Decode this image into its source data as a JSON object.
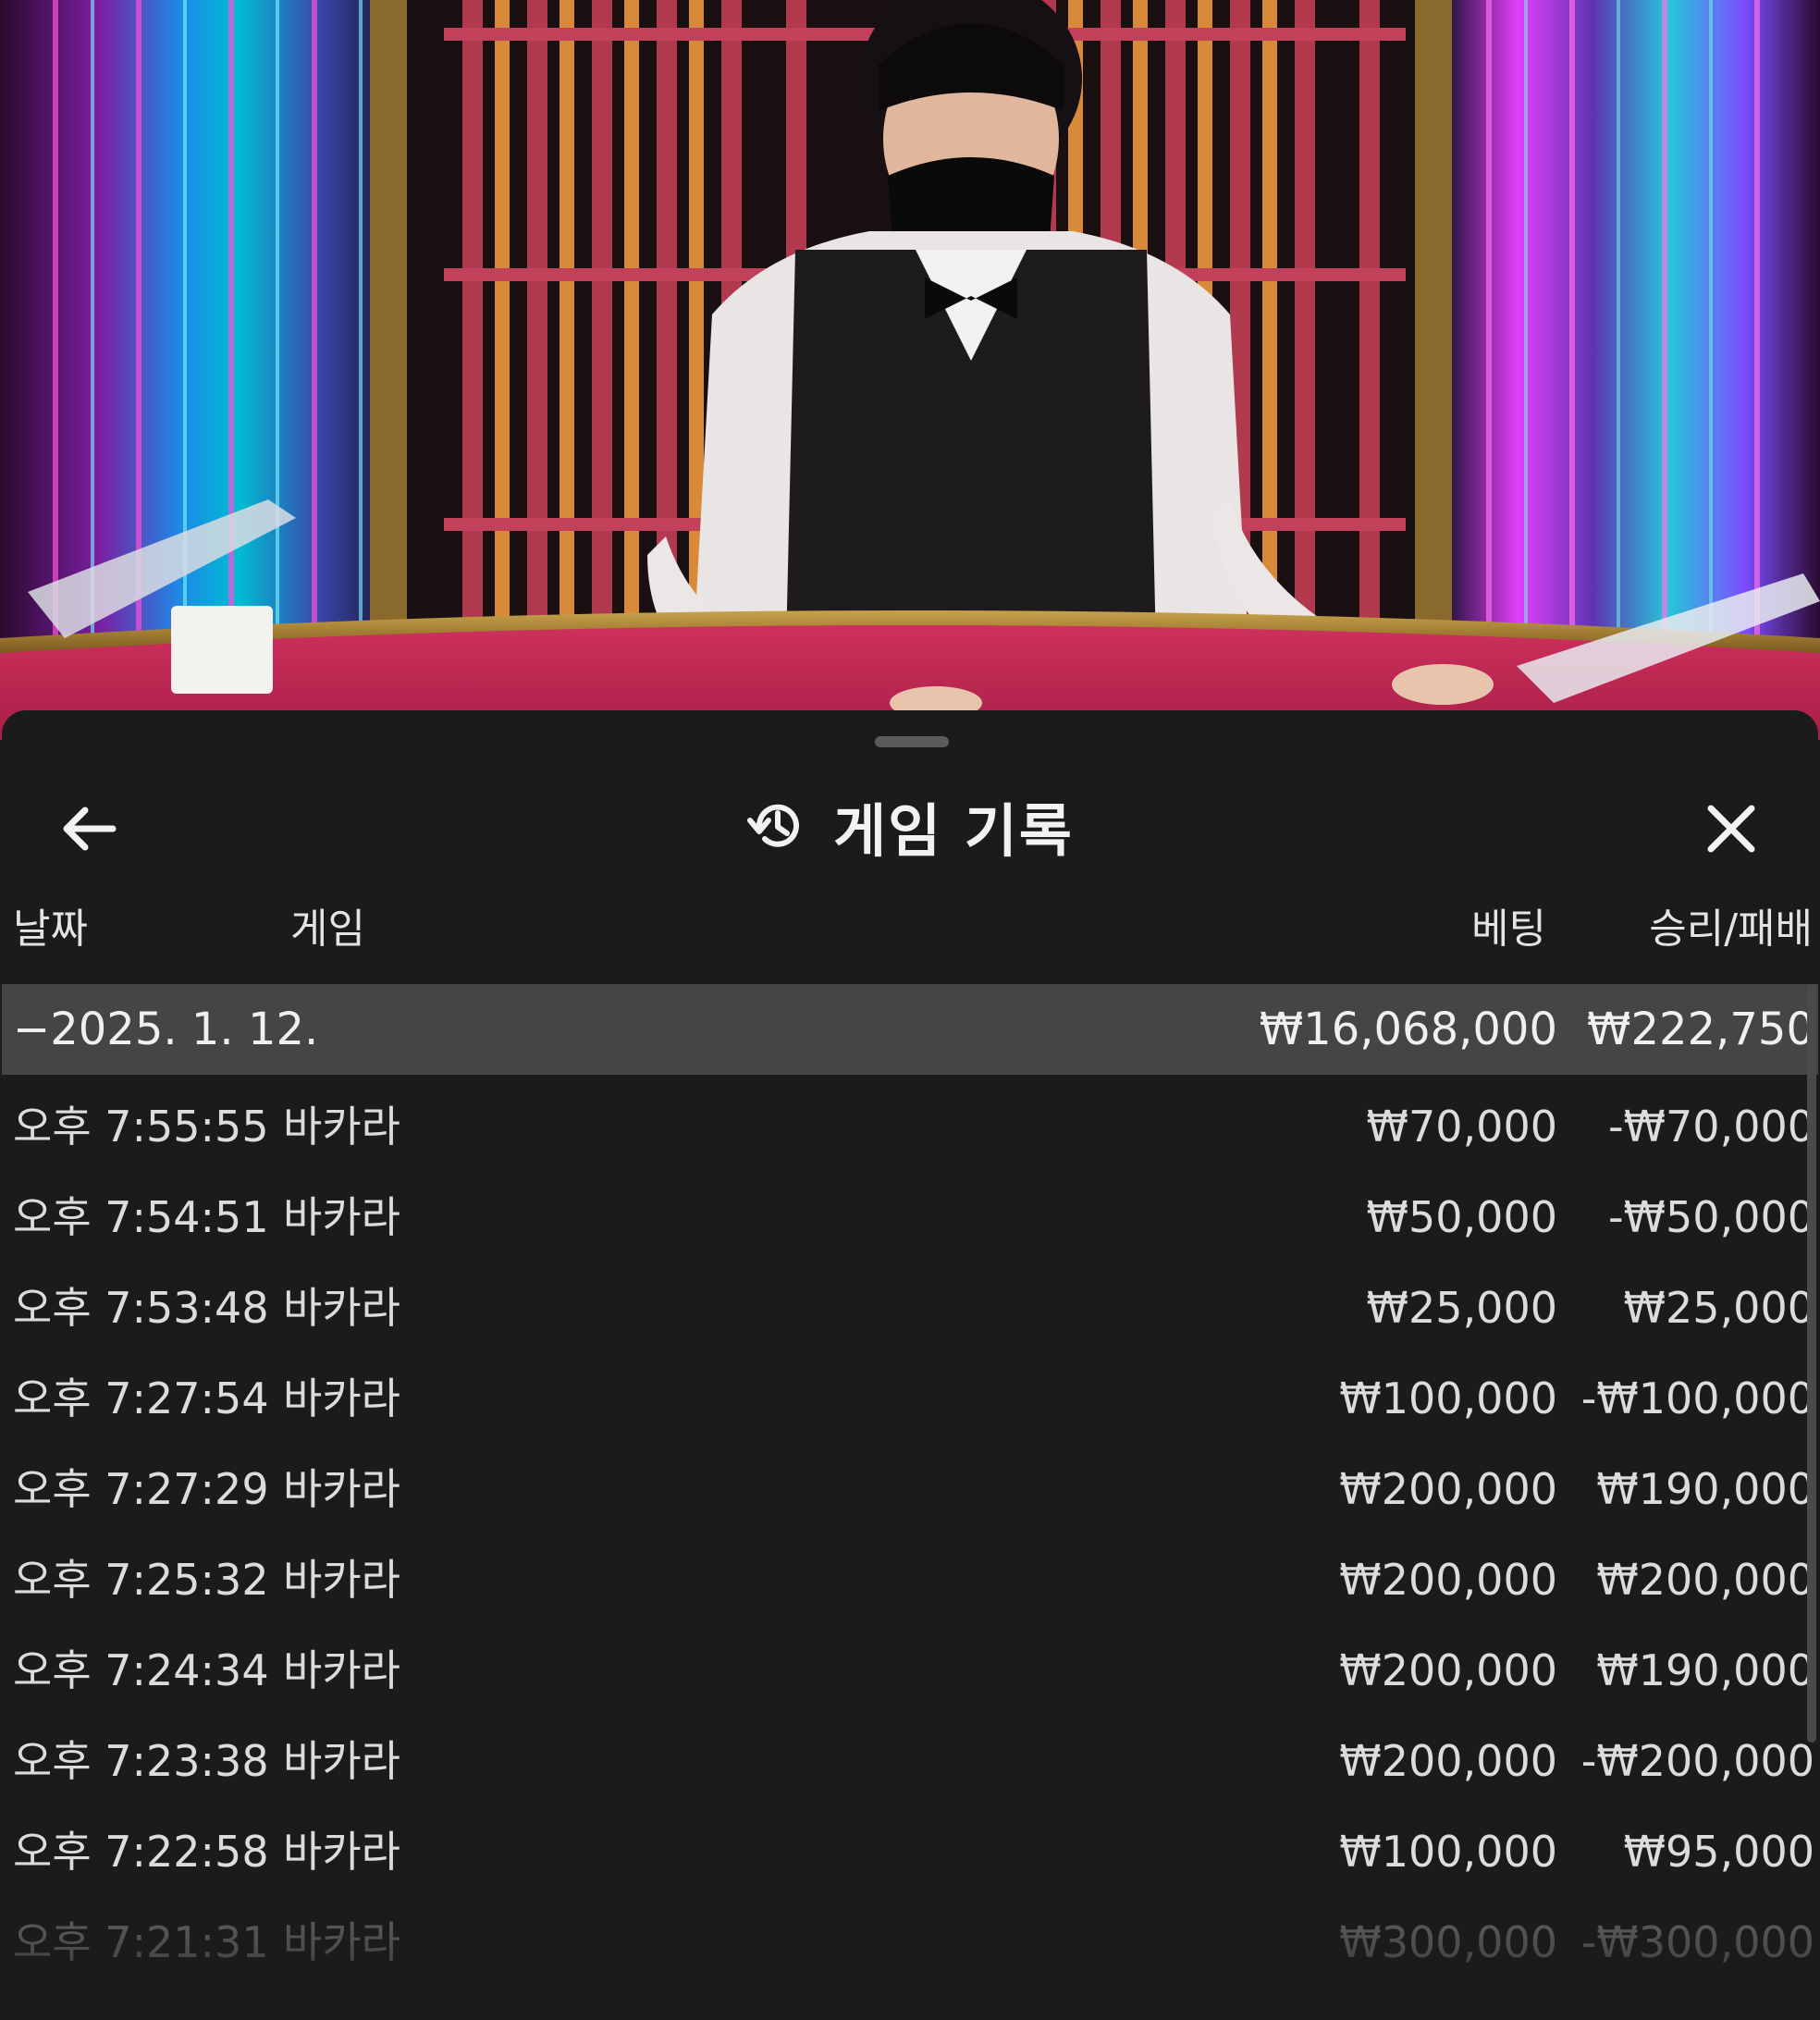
{
  "sheet": {
    "title": "게임 기록",
    "back_icon": "arrow-left-icon",
    "history_icon": "history-clock-icon",
    "close_icon": "close-x-icon"
  },
  "columns": {
    "date": "날짜",
    "game": "게임",
    "bet": "베팅",
    "win_loss": "승리/패배"
  },
  "group": {
    "date": "−2025. 1. 12.",
    "bet_total": "₩16,068,000",
    "win_total": "₩222,750"
  },
  "rows": [
    {
      "time": "오후 7:55:55",
      "game": "바카라",
      "bet": "₩70,000",
      "win": "-₩70,000"
    },
    {
      "time": "오후 7:54:51",
      "game": "바카라",
      "bet": "₩50,000",
      "win": "-₩50,000"
    },
    {
      "time": "오후 7:53:48",
      "game": "바카라",
      "bet": "₩25,000",
      "win": "₩25,000"
    },
    {
      "time": "오후 7:27:54",
      "game": "바카라",
      "bet": "₩100,000",
      "win": "-₩100,000"
    },
    {
      "time": "오후 7:27:29",
      "game": "바카라",
      "bet": "₩200,000",
      "win": "₩190,000"
    },
    {
      "time": "오후 7:25:32",
      "game": "바카라",
      "bet": "₩200,000",
      "win": "₩200,000"
    },
    {
      "time": "오후 7:24:34",
      "game": "바카라",
      "bet": "₩200,000",
      "win": "₩190,000"
    },
    {
      "time": "오후 7:23:38",
      "game": "바카라",
      "bet": "₩200,000",
      "win": "-₩200,000"
    },
    {
      "time": "오후 7:22:58",
      "game": "바카라",
      "bet": "₩100,000",
      "win": "₩95,000"
    },
    {
      "time": "오후 7:21:31",
      "game": "바카라",
      "bet": "₩300,000",
      "win": "-₩300,000"
    }
  ],
  "colors": {
    "sheet_bg": "#1b1b1c",
    "group_row_bg": "#454546",
    "table_felt": "#c42a55",
    "text": "#dcdcdc"
  }
}
